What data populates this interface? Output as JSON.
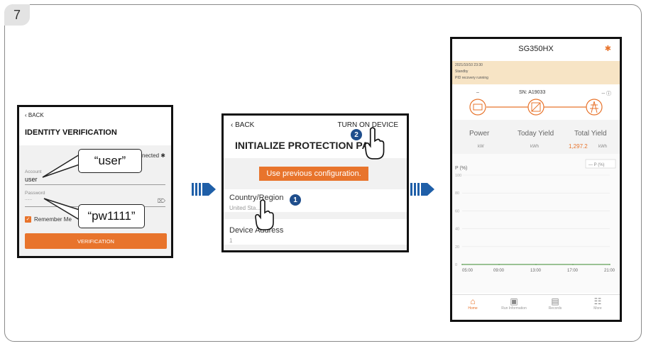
{
  "step": "7",
  "screen1": {
    "back": "BACK",
    "title": "IDENTITY VERIFICATION",
    "connected": "nected",
    "account_label": "Account",
    "account_value": "user",
    "password_label": "Password",
    "password_value": "......",
    "remember": "Remember Me",
    "verify_button": "VERIFICATION",
    "callout_user": "“user”",
    "callout_pw": "“pw1111”"
  },
  "screen2": {
    "back": "BACK",
    "turn_on": "TURN ON DEVICE",
    "title": "INITIALIZE PROTECTION PAR...",
    "use_previous": "Use previous configuration.",
    "country_label": "Country/Region",
    "country_value": "United Sta...",
    "device_label": "Device Address",
    "device_value": "1",
    "badge1": "1",
    "badge2": "2"
  },
  "screen3": {
    "title": "SG350HX",
    "timestamp": "2021/10/10 23:30",
    "status1": "Standby",
    "status2": "PID recovery running",
    "left_value": "–",
    "sn": "SN: A19033",
    "right_value": "-- ⓘ",
    "power_label": "Power",
    "power_unit": "kW",
    "today_label": "Today Yield",
    "today_unit": "kWh",
    "total_label": "Total Yield",
    "total_value": "1,297.2",
    "total_unit": "kWh",
    "legend": "— P (%)",
    "y_title": "P (%)",
    "nav": [
      "Home",
      "Run Information",
      "Records",
      "More"
    ],
    "accent": "#e8742c"
  },
  "chart_data": {
    "type": "line",
    "ylabel": "P (%)",
    "yticks": [
      0,
      20,
      40,
      60,
      80,
      100
    ],
    "xticks": [
      "05:00",
      "09:00",
      "13:00",
      "17:00",
      "21:00"
    ],
    "ylim": [
      0,
      100
    ],
    "series": [
      {
        "name": "P (%)",
        "values": [
          0,
          0,
          0,
          0,
          0
        ]
      }
    ]
  }
}
